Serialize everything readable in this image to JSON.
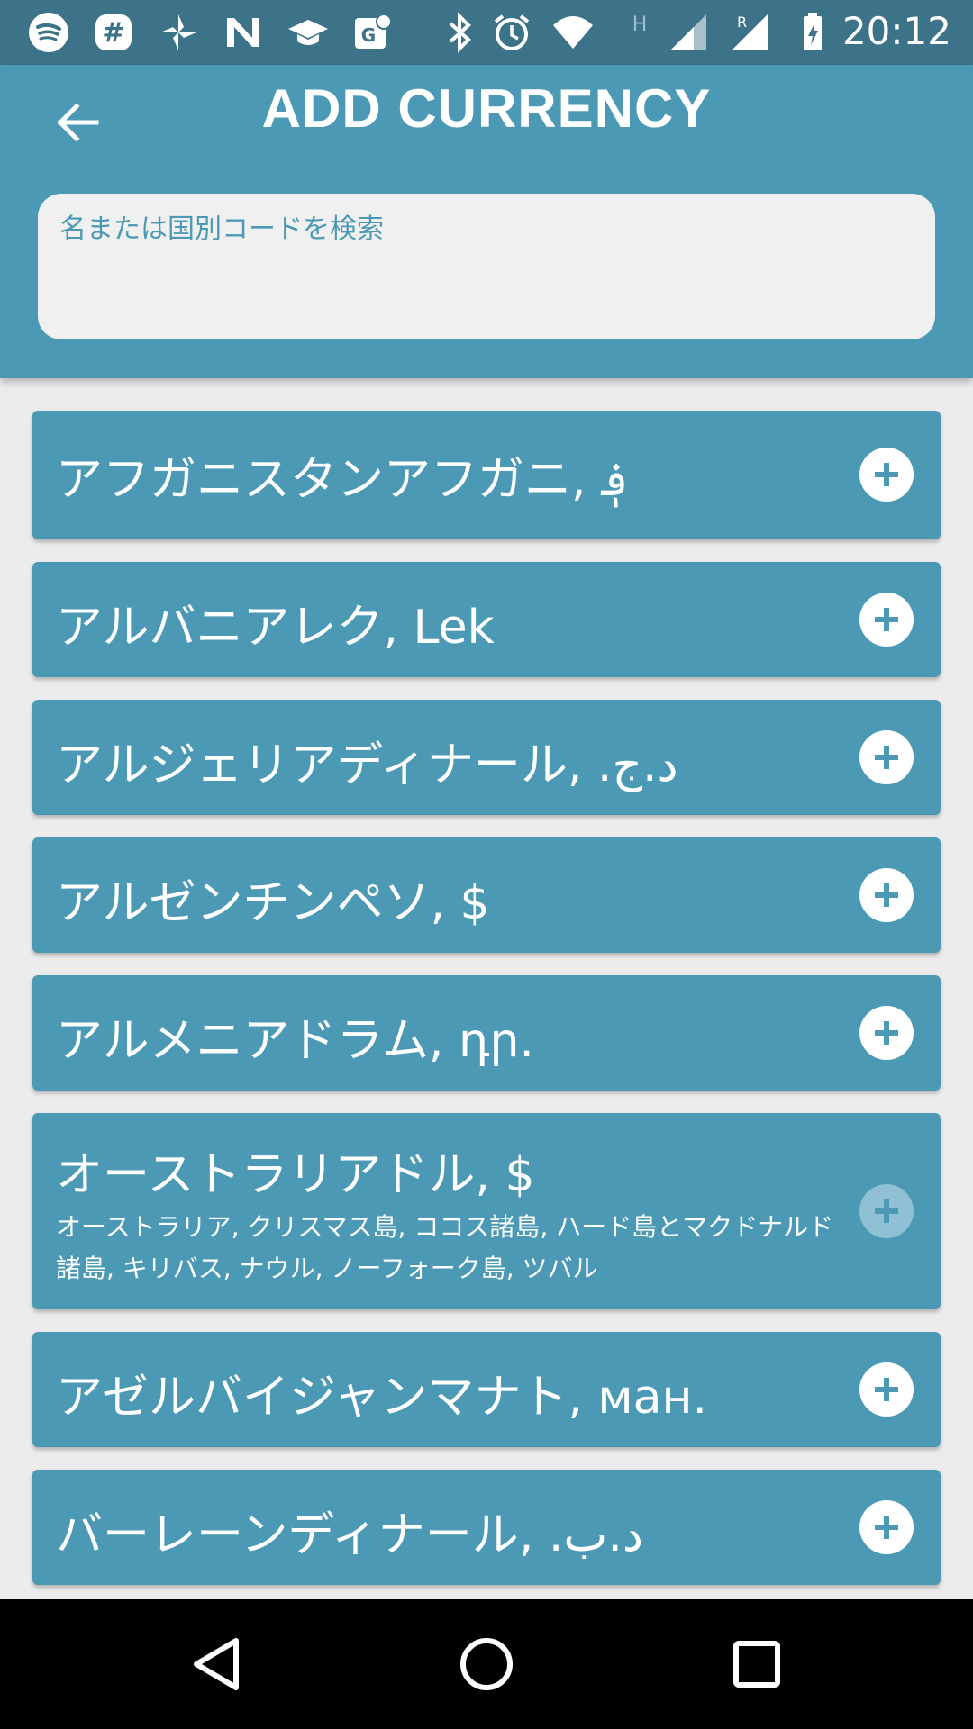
{
  "status_bar": {
    "time": "20:12",
    "notification_icons": [
      "spotify-icon",
      "slack-icon",
      "pinwheel-icon",
      "n-app-icon",
      "graduation-cap-icon",
      "maps-icon"
    ],
    "system_icons": [
      "bluetooth-icon",
      "alarm-icon",
      "wifi-icon",
      "h-signal-icon",
      "cell-signal-icon",
      "roaming-signal-icon",
      "battery-icon"
    ]
  },
  "header": {
    "title": "ADD CURRENCY",
    "back_icon": "arrow-left-icon",
    "search": {
      "placeholder": "名または国別コードを検索",
      "value": ""
    },
    "colors": {
      "bar": "#4b99b4",
      "status": "#3d7389"
    }
  },
  "currencies": [
    {
      "label": "アフガニスタンアフガニ, ؋"
    },
    {
      "label": "アルバニアレク, Lek"
    },
    {
      "label": "アルジェリアディナール, .د.ج"
    },
    {
      "label": "アルゼンチンペソ, $"
    },
    {
      "label": "アルメニアドラム, դր."
    },
    {
      "label": "オーストラリアドル, $",
      "countries": "オーストラリア, クリスマス島, ココス諸島, ハード島とマクドナルド諸島, キリバス, ナウル, ノーフォーク島, ツバル",
      "add_disabled": true
    },
    {
      "label": "アゼルバイジャンマナト, ман."
    },
    {
      "label": "バーレーンディナール, .د.ب"
    }
  ],
  "nav_bar": {
    "buttons": [
      "back-triangle-icon",
      "home-circle-icon",
      "recents-square-icon"
    ]
  }
}
